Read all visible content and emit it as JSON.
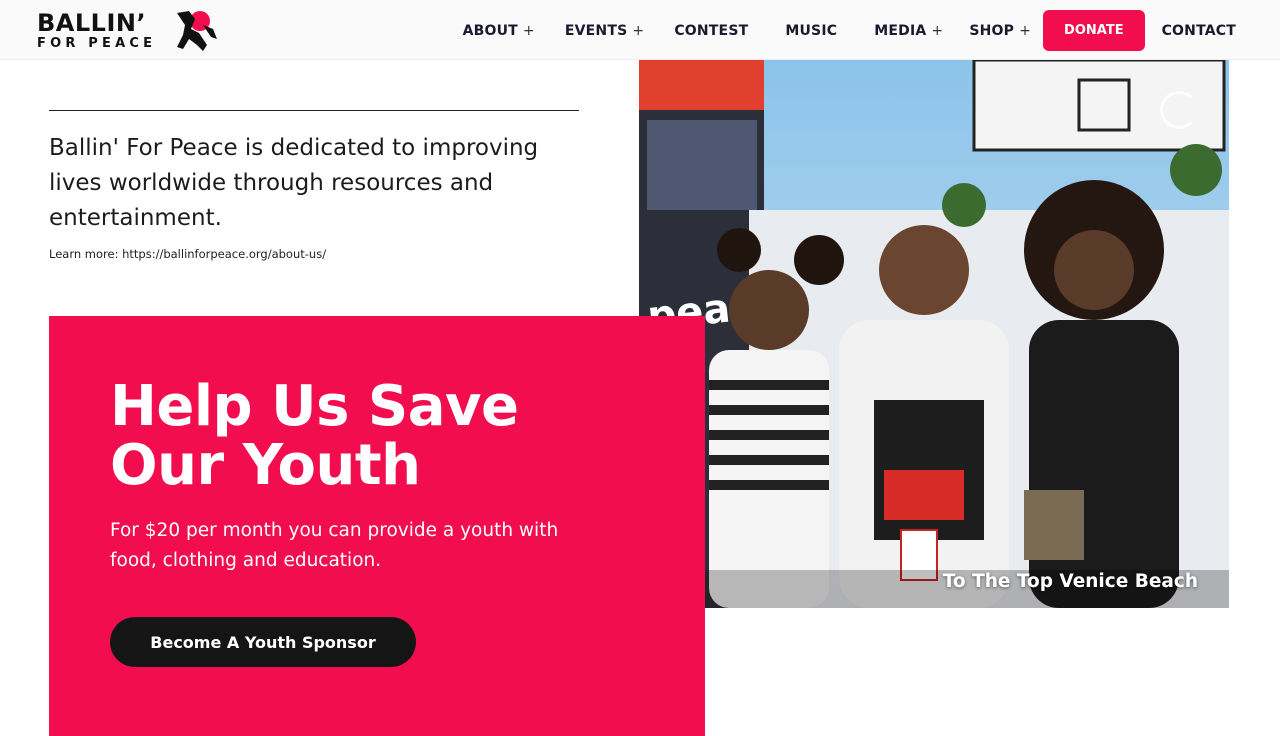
{
  "brand": {
    "line1": "BALLIN’",
    "line2": "FOR PEACE",
    "accent_color": "#f10d4e"
  },
  "nav": {
    "items": [
      {
        "label": "ABOUT",
        "has_submenu": true
      },
      {
        "label": "EVENTS",
        "has_submenu": true
      },
      {
        "label": "CONTEST",
        "has_submenu": false
      },
      {
        "label": "MUSIC",
        "has_submenu": false
      },
      {
        "label": "MEDIA",
        "has_submenu": true
      },
      {
        "label": "SHOP",
        "has_submenu": true
      }
    ],
    "plus": "+",
    "donate_label": "DONATE",
    "contact_label": "CONTACT"
  },
  "intro": {
    "mission": "Ballin' For Peace is dedicated to improving lives worldwide through resources and entertainment.",
    "learn_more": "Learn more: https://ballinforpeace.org/about-us/"
  },
  "slideshow": {
    "caption": "To The Top Venice Beach"
  },
  "cta": {
    "title": "Help Us Save Our Youth",
    "text": "For $20 per month you can provide a youth with food, clothing and education.",
    "button_label": "Become A Youth Sponsor"
  }
}
